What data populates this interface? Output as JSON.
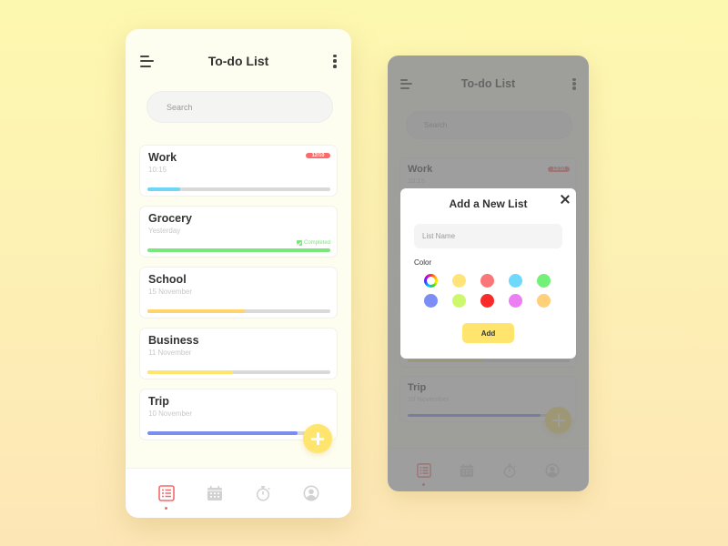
{
  "app": {
    "title": "To-do List",
    "search_placeholder": "Search"
  },
  "lists": [
    {
      "name": "Work",
      "subtitle": "10:15",
      "badge": "12/10",
      "progress": 0.18,
      "color": "#6fd6f8"
    },
    {
      "name": "Grocery",
      "subtitle": "Yesterday",
      "status": "Completed",
      "progress": 1.0,
      "color": "#79e779"
    },
    {
      "name": "School",
      "subtitle": "15 November",
      "progress": 0.53,
      "color": "#ffd36e"
    },
    {
      "name": "Business",
      "subtitle": "11 November",
      "progress": 0.47,
      "color": "#ffe46e"
    },
    {
      "name": "Trip",
      "subtitle": "10 November",
      "progress": 0.82,
      "color": "#7b8ef0"
    }
  ],
  "fab_icon": "plus-icon",
  "bottom_nav": [
    {
      "id": "lists",
      "icon": "list-icon",
      "active": true
    },
    {
      "id": "calendar",
      "icon": "calendar-icon",
      "active": false
    },
    {
      "id": "timer",
      "icon": "stopwatch-icon",
      "active": false
    },
    {
      "id": "profile",
      "icon": "user-icon",
      "active": false
    }
  ],
  "colors": {
    "accent_active": "#f26b6b",
    "inactive_icon": "#cfcfcf",
    "badge": "#fb6b6b",
    "fab": "#ffe46e"
  },
  "modal": {
    "title": "Add a New List",
    "input_placeholder": "List Name",
    "color_label": "Color",
    "add_label": "Add",
    "swatches": [
      "custom",
      "#ffe47a",
      "#fb7676",
      "#6fd9fb",
      "#73f078",
      "#7b8ef5",
      "#cdf86e",
      "#f82a2a",
      "#ec7ef3",
      "#ffd07a"
    ]
  }
}
